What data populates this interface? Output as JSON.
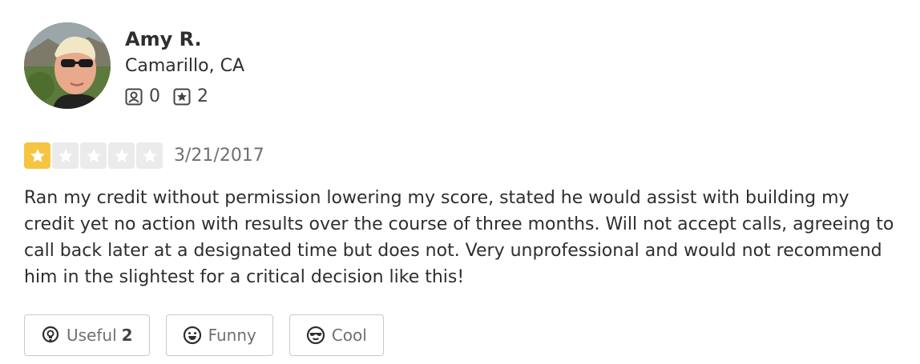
{
  "user": {
    "name": "Amy R.",
    "location": "Camarillo, CA",
    "friends_count": "0",
    "reviews_count": "2",
    "avatar_icon": "user-photo"
  },
  "review": {
    "rating": 1,
    "max_rating": 5,
    "date": "3/21/2017",
    "text": "Ran my credit without permission lowering my score, stated he would assist with building my credit yet no action with results over the course of three months. Will not accept calls, agreeing to call back later at a designated time but does not. Very unprofessional and would not recommend him in the slightest for a critical decision like this!"
  },
  "actions": {
    "useful_label": "Useful",
    "useful_count": "2",
    "funny_label": "Funny",
    "cool_label": "Cool"
  },
  "colors": {
    "star_on": "#f5c542",
    "star_off": "#ebebeb",
    "text": "#2d2e2f",
    "muted": "#6e7072",
    "border": "#c8c9ca"
  }
}
